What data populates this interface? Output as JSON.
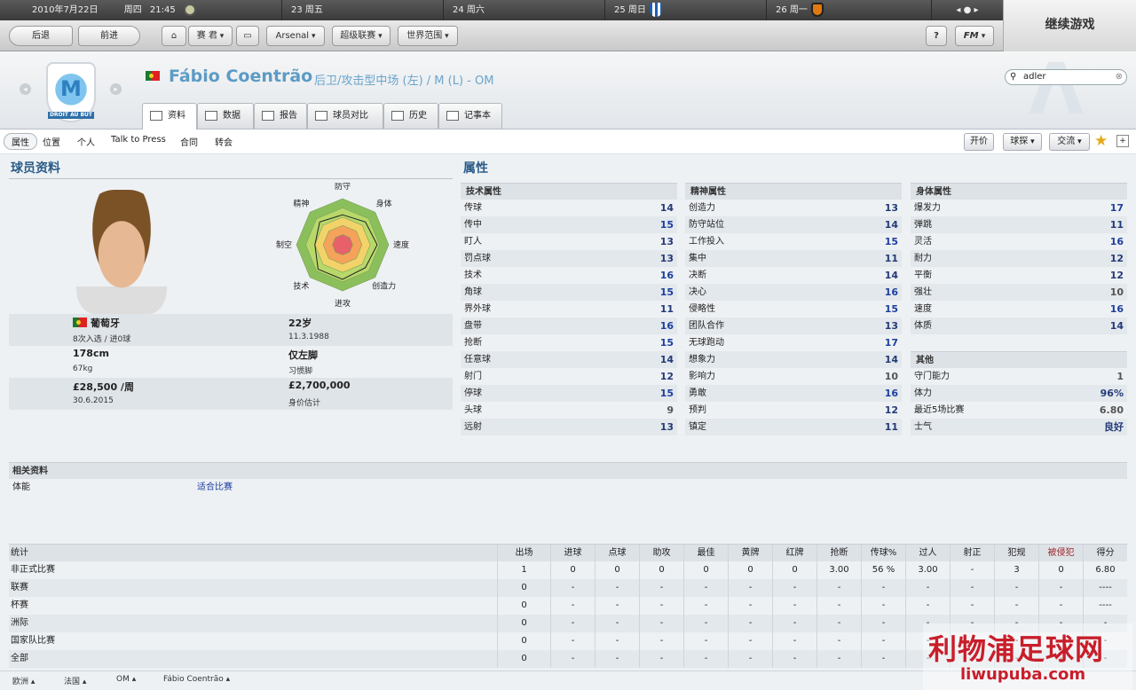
{
  "topbar": {
    "date": "2010年7月22日",
    "day": "周四",
    "time": "21:45",
    "days": [
      "23 周五",
      "24 周六",
      "25 周日",
      "26 周一"
    ]
  },
  "continue_label": "继续游戏",
  "toolbar": {
    "back": "后退",
    "forward": "前进",
    "club": "Arsenal",
    "league": "超级联赛",
    "world": "世界范围",
    "coach_icon": "coach-icon",
    "help": "?",
    "fm": "FM",
    "dropdown_primary": "赛 君"
  },
  "player": {
    "name": "Fábio Coentrão",
    "position": "后卫/攻击型中场 (左) / M (L) - OM",
    "nation": "葡萄牙",
    "caps": "8次入选 / 进0球",
    "age": "22岁",
    "dob": "11.3.1988",
    "height": "178cm",
    "weight": "67kg",
    "foot": "仅左脚",
    "foot_label": "习惯脚",
    "wage": "£28,500 /周",
    "contract": "30.6.2015",
    "value": "£2,700,000",
    "value_label": "身价估计"
  },
  "search_value": "adler",
  "tabs": [
    "资料",
    "数据",
    "报告",
    "球员对比",
    "历史",
    "记事本"
  ],
  "subnav": [
    "属性",
    "位置",
    "个人",
    "Talk to Press",
    "合同",
    "转会"
  ],
  "actions": {
    "offer": "开价",
    "scout": "球探",
    "interact": "交流"
  },
  "profile_title": "球员资料",
  "attributes_title": "属性",
  "radar": {
    "labels": [
      "防守",
      "身体",
      "速度",
      "创造力",
      "进攻",
      "技术",
      "制空",
      "精神"
    ],
    "values": [
      13,
      14,
      15,
      14,
      15,
      15,
      12,
      14
    ]
  },
  "technical": {
    "title": "技术属性",
    "items": [
      [
        "传球",
        14
      ],
      [
        "传中",
        15
      ],
      [
        "盯人",
        13
      ],
      [
        "罚点球",
        13
      ],
      [
        "技术",
        16
      ],
      [
        "角球",
        15
      ],
      [
        "界外球",
        11
      ],
      [
        "盘带",
        16
      ],
      [
        "抢断",
        15
      ],
      [
        "任意球",
        14
      ],
      [
        "射门",
        12
      ],
      [
        "停球",
        15
      ],
      [
        "头球",
        9
      ],
      [
        "远射",
        13
      ]
    ]
  },
  "mental": {
    "title": "精神属性",
    "items": [
      [
        "创造力",
        13
      ],
      [
        "防守站位",
        14
      ],
      [
        "工作投入",
        15
      ],
      [
        "集中",
        11
      ],
      [
        "决断",
        14
      ],
      [
        "决心",
        16
      ],
      [
        "侵略性",
        15
      ],
      [
        "团队合作",
        13
      ],
      [
        "无球跑动",
        17
      ],
      [
        "想象力",
        14
      ],
      [
        "影响力",
        10
      ],
      [
        "勇敢",
        16
      ],
      [
        "预判",
        12
      ],
      [
        "镇定",
        11
      ]
    ]
  },
  "physical": {
    "title": "身体属性",
    "items": [
      [
        "爆发力",
        17
      ],
      [
        "弹跳",
        11
      ],
      [
        "灵活",
        16
      ],
      [
        "耐力",
        12
      ],
      [
        "平衡",
        12
      ],
      [
        "强壮",
        10
      ],
      [
        "速度",
        16
      ],
      [
        "体质",
        14
      ]
    ]
  },
  "other": {
    "title": "其他",
    "items": [
      [
        "守门能力",
        "1"
      ],
      [
        "体力",
        "96%"
      ],
      [
        "最近5场比赛",
        "6.80"
      ],
      [
        "士气",
        "良好"
      ]
    ]
  },
  "related": {
    "title": "相关资料",
    "label": "体能",
    "value": "适合比赛"
  },
  "stats": {
    "headers": [
      "统计",
      "出场",
      "进球",
      "点球",
      "助攻",
      "最佳",
      "黄牌",
      "红牌",
      "抢断",
      "传球%",
      "过人",
      "射正",
      "犯规",
      "被侵犯",
      "得分"
    ],
    "rows": [
      [
        "非正式比赛",
        "1",
        "0",
        "0",
        "0",
        "0",
        "0",
        "0",
        "3.00",
        "56 %",
        "3.00",
        "-",
        "3",
        "0",
        "6.80"
      ],
      [
        "联赛",
        "0",
        "-",
        "-",
        "-",
        "-",
        "-",
        "-",
        "-",
        "-",
        "-",
        "-",
        "-",
        "-",
        "----"
      ],
      [
        "杯赛",
        "0",
        "-",
        "-",
        "-",
        "-",
        "-",
        "-",
        "-",
        "-",
        "-",
        "-",
        "-",
        "-",
        "----"
      ],
      [
        "洲际",
        "0",
        "-",
        "-",
        "-",
        "-",
        "-",
        "-",
        "-",
        "-",
        "-",
        "-",
        "-",
        "-",
        "-"
      ],
      [
        "国家队比赛",
        "0",
        "-",
        "-",
        "-",
        "-",
        "-",
        "-",
        "-",
        "-",
        "-",
        "-",
        "-",
        "-",
        "-"
      ],
      [
        "全部",
        "0",
        "-",
        "-",
        "-",
        "-",
        "-",
        "-",
        "-",
        "-",
        "-",
        "-",
        "-",
        "-",
        "-"
      ]
    ]
  },
  "footer": [
    "欧洲",
    "法国",
    "OM",
    "Fábio Coentrão"
  ],
  "watermark": {
    "cn": "利物浦足球网",
    "en": "liwupuba.com"
  },
  "colors": {
    "accent": "#2b5c88",
    "value_high": "#1d3f9e",
    "watermark": "#c81e2a"
  }
}
